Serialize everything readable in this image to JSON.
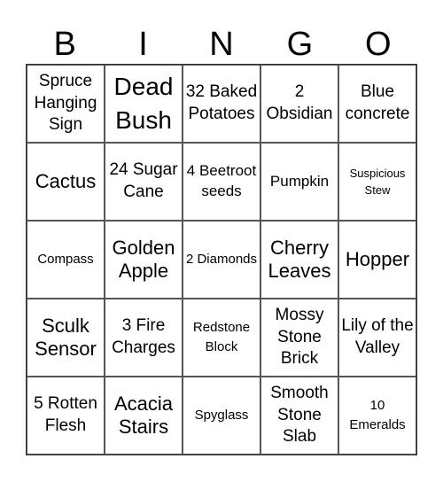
{
  "header": {
    "letters": [
      "B",
      "I",
      "N",
      "G",
      "O"
    ]
  },
  "cells": [
    "Spruce Hanging Sign",
    "Dead Bush",
    "32 Baked Potatoes",
    "2 Obsidian",
    "Blue concrete",
    "Cactus",
    "24 Sugar Cane",
    "4 Beetroot seeds",
    "Pumpkin",
    "Suspicious Stew",
    "Compass",
    "Golden Apple",
    "2 Diamonds",
    "Cherry Leaves",
    "Hopper",
    "Sculk Sensor",
    "3 Fire Charges",
    "Redstone Block",
    "Mossy Stone Brick",
    "Lily of the Valley",
    "5 Rotten Flesh",
    "Acacia Stairs",
    "Spyglass",
    "Smooth Stone Slab",
    "10 Emeralds"
  ]
}
